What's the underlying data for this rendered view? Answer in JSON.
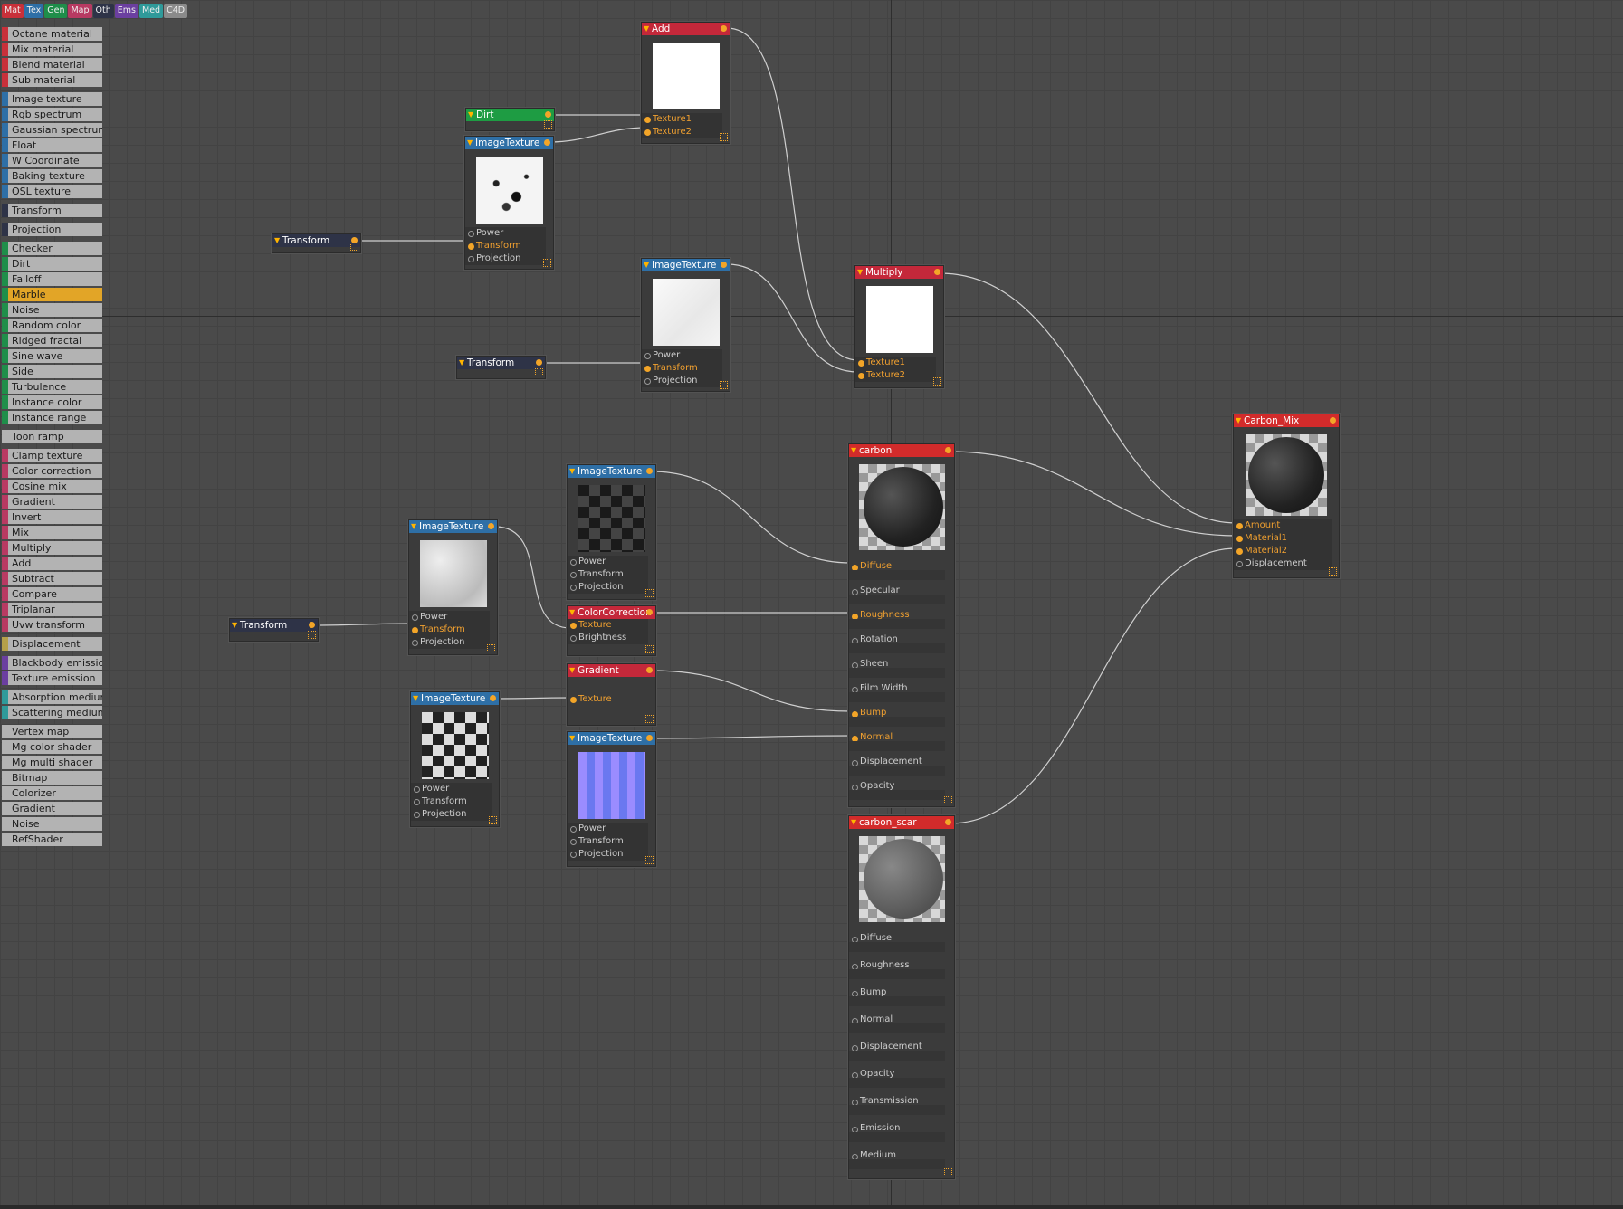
{
  "tabs": [
    {
      "label": "Mat",
      "color": "#c8303a"
    },
    {
      "label": "Tex",
      "color": "#2e6fa6"
    },
    {
      "label": "Gen",
      "color": "#1f8e4a"
    },
    {
      "label": "Map",
      "color": "#b83a62"
    },
    {
      "label": "Oth",
      "color": "#2e3347"
    },
    {
      "label": "Ems",
      "color": "#6b3fa0"
    },
    {
      "label": "Med",
      "color": "#2f9a9a"
    },
    {
      "label": "C4D",
      "color": "#8a8a8a"
    }
  ],
  "palette": [
    {
      "label": "Octane material",
      "color": "#c8303a"
    },
    {
      "label": "Mix material",
      "color": "#c8303a"
    },
    {
      "label": "Blend material",
      "color": "#c8303a"
    },
    {
      "label": "Sub material",
      "color": "#c8303a",
      "gap_after": true
    },
    {
      "label": "Image texture",
      "color": "#2e6fa6"
    },
    {
      "label": "Rgb spectrum",
      "color": "#2e6fa6"
    },
    {
      "label": "Gaussian spectrum",
      "color": "#2e6fa6"
    },
    {
      "label": "Float",
      "color": "#2e6fa6"
    },
    {
      "label": "W Coordinate",
      "color": "#2e6fa6"
    },
    {
      "label": "Baking texture",
      "color": "#2e6fa6"
    },
    {
      "label": "OSL texture",
      "color": "#2e6fa6",
      "gap_after": true
    },
    {
      "label": "Transform",
      "color": "#2e3347",
      "gap_after": true
    },
    {
      "label": "Projection",
      "color": "#2e3347",
      "gap_after": true
    },
    {
      "label": "Checker",
      "color": "#1f8e4a"
    },
    {
      "label": "Dirt",
      "color": "#1f8e4a"
    },
    {
      "label": "Falloff",
      "color": "#1f8e4a"
    },
    {
      "label": "Marble",
      "color": "#1f8e4a",
      "selected": true
    },
    {
      "label": "Noise",
      "color": "#1f8e4a"
    },
    {
      "label": "Random color",
      "color": "#1f8e4a"
    },
    {
      "label": "Ridged fractal",
      "color": "#1f8e4a"
    },
    {
      "label": "Sine wave",
      "color": "#1f8e4a"
    },
    {
      "label": "Side",
      "color": "#1f8e4a"
    },
    {
      "label": "Turbulence",
      "color": "#1f8e4a"
    },
    {
      "label": "Instance color",
      "color": "#1f8e4a"
    },
    {
      "label": "Instance range",
      "color": "#1f8e4a",
      "gap_after": true
    },
    {
      "label": "Toon ramp",
      "color": "#b3b3b3",
      "gap_after": true
    },
    {
      "label": "Clamp texture",
      "color": "#b83a62"
    },
    {
      "label": "Color correction",
      "color": "#b83a62"
    },
    {
      "label": "Cosine mix",
      "color": "#b83a62"
    },
    {
      "label": "Gradient",
      "color": "#b83a62"
    },
    {
      "label": "Invert",
      "color": "#b83a62"
    },
    {
      "label": "Mix",
      "color": "#b83a62"
    },
    {
      "label": "Multiply",
      "color": "#b83a62"
    },
    {
      "label": "Add",
      "color": "#b83a62"
    },
    {
      "label": "Subtract",
      "color": "#b83a62"
    },
    {
      "label": "Compare",
      "color": "#b83a62"
    },
    {
      "label": "Triplanar",
      "color": "#b83a62"
    },
    {
      "label": "Uvw transform",
      "color": "#b83a62",
      "gap_after": true
    },
    {
      "label": "Displacement",
      "color": "#b5a04a",
      "gap_after": true
    },
    {
      "label": "Blackbody emission",
      "color": "#6b3fa0"
    },
    {
      "label": "Texture emission",
      "color": "#6b3fa0",
      "gap_after": true
    },
    {
      "label": "Absorption medium",
      "color": "#2f9a9a"
    },
    {
      "label": "Scattering medium",
      "color": "#2f9a9a",
      "gap_after": true
    },
    {
      "label": "Vertex map",
      "color": "#b3b3b3"
    },
    {
      "label": "Mg color shader",
      "color": "#b3b3b3"
    },
    {
      "label": "Mg multi shader",
      "color": "#b3b3b3"
    },
    {
      "label": "Bitmap",
      "color": "#b3b3b3"
    },
    {
      "label": "Colorizer",
      "color": "#b3b3b3"
    },
    {
      "label": "Gradient",
      "color": "#b3b3b3"
    },
    {
      "label": "Noise",
      "color": "#b3b3b3"
    },
    {
      "label": "RefShader",
      "color": "#b3b3b3"
    }
  ],
  "nodes": {
    "add": {
      "title": "Add",
      "ports": [
        "Texture1",
        "Texture2"
      ]
    },
    "dirt": {
      "title": "Dirt"
    },
    "img1": {
      "title": "ImageTexture",
      "ports": [
        "Power",
        "Transform",
        "Projection"
      ]
    },
    "tr1": {
      "title": "Transform"
    },
    "img2": {
      "title": "ImageTexture",
      "ports": [
        "Power",
        "Transform",
        "Projection"
      ]
    },
    "tr2": {
      "title": "Transform"
    },
    "multiply": {
      "title": "Multiply",
      "ports": [
        "Texture1",
        "Texture2"
      ]
    },
    "carbon_mix": {
      "title": "Carbon_Mix",
      "ports": [
        "Amount",
        "Material1",
        "Material2",
        "Displacement"
      ]
    },
    "carbon": {
      "title": "carbon",
      "ports": [
        "Diffuse",
        "Specular",
        "Roughness",
        "Rotation",
        "Sheen",
        "Film Width",
        "Bump",
        "Normal",
        "Displacement",
        "Opacity"
      ]
    },
    "img3": {
      "title": "ImageTexture",
      "ports": [
        "Power",
        "Transform",
        "Projection"
      ]
    },
    "img4": {
      "title": "ImageTexture",
      "ports": [
        "Power",
        "Transform",
        "Projection"
      ]
    },
    "tr3": {
      "title": "Transform"
    },
    "cc": {
      "title": "ColorCorrection",
      "ports": [
        "Texture",
        "Brightness"
      ]
    },
    "grad": {
      "title": "Gradient",
      "ports": [
        "Texture"
      ]
    },
    "img5": {
      "title": "ImageTexture",
      "ports": [
        "Power",
        "Transform",
        "Projection"
      ]
    },
    "img6": {
      "title": "ImageTexture",
      "ports": [
        "Power",
        "Transform",
        "Projection"
      ]
    },
    "carbon_scar": {
      "title": "carbon_scar",
      "ports": [
        "Diffuse",
        "Roughness",
        "Bump",
        "Normal",
        "Displacement",
        "Opacity",
        "Transmission",
        "Emission",
        "Medium"
      ]
    }
  }
}
